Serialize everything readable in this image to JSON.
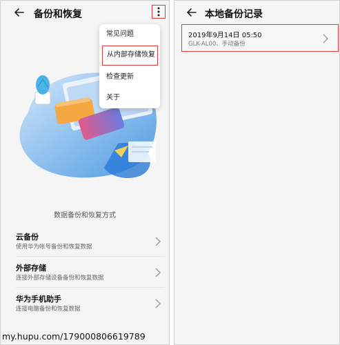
{
  "left": {
    "header": {
      "title": "备份和恢复"
    },
    "menu": {
      "items": [
        {
          "label": "常见问题"
        },
        {
          "label": "从内部存储恢复"
        },
        {
          "label": "检查更新"
        },
        {
          "label": "关于"
        }
      ]
    },
    "section_title": "数据备份和恢复方式",
    "options": [
      {
        "title": "云备份",
        "subtitle": "使用华为帐号备份和恢复数据"
      },
      {
        "title": "外部存储",
        "subtitle": "连接外部存储设备备份和恢复数据"
      },
      {
        "title": "华为手机助手",
        "subtitle": "连接电脑备份和恢复数据"
      }
    ]
  },
  "right": {
    "header": {
      "title": "本地备份记录"
    },
    "record": {
      "title": "2019年9月14日 05:50",
      "subtitle": "GLK-AL00、手动备份"
    }
  },
  "watermark": "my.hupu.com/179000806619789",
  "colors": {
    "highlight": "#e03a3a",
    "background": "#f5f5f5",
    "illustration_blue": "#3b8fe0"
  },
  "icons": [
    "back-arrow-icon",
    "more-vertical-icon",
    "chevron-right-icon"
  ]
}
